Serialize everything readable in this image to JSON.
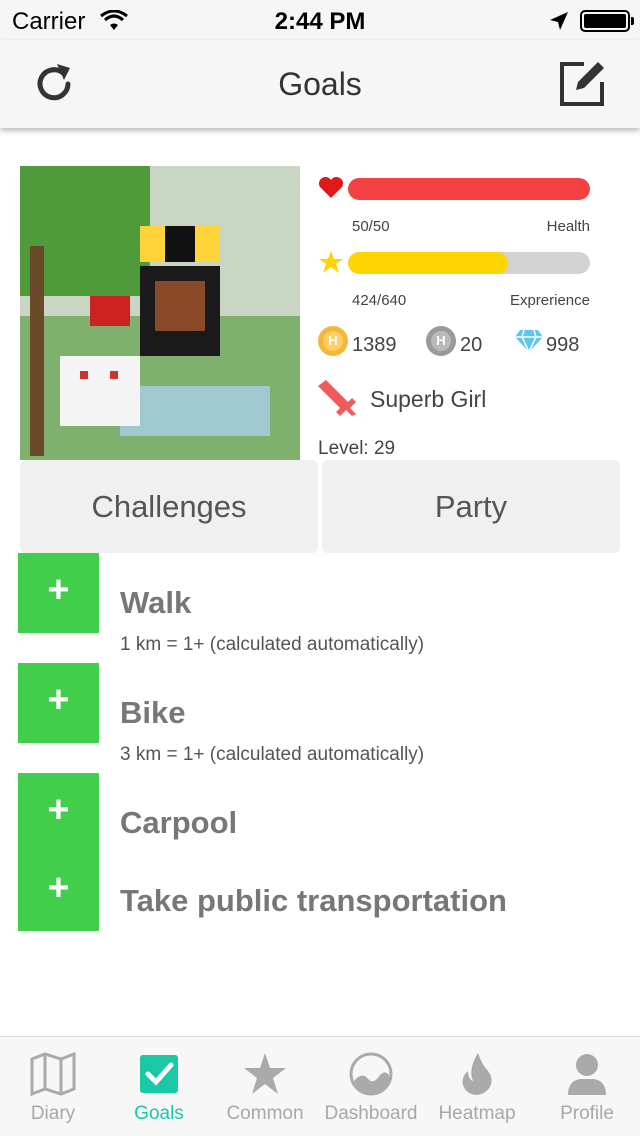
{
  "status_bar": {
    "carrier": "Carrier",
    "time": "2:44 PM"
  },
  "nav": {
    "title": "Goals",
    "left_icon": "refresh-icon",
    "right_icon": "edit-icon"
  },
  "stats": {
    "health": {
      "value": "50/50",
      "label": "Health",
      "fraction": 1.0,
      "color": "#f44040"
    },
    "experience": {
      "value": "424/640",
      "label": "Exprerience",
      "fraction": 0.6625,
      "color": "#ffd500"
    },
    "gold": "1389",
    "silver": "20",
    "gems": "998",
    "class_name": "Superb Girl",
    "level": "Level: 29"
  },
  "tabs": [
    {
      "label": "Challenges"
    },
    {
      "label": "Party"
    }
  ],
  "habits": [
    {
      "title": "Walk",
      "note": "1 km = 1+ (calculated automatically)"
    },
    {
      "title": "Bike",
      "note": "3 km = 1+ (calculated automatically)"
    },
    {
      "title": "Carpool",
      "note": ""
    },
    {
      "title": "Take public transportation",
      "note": ""
    }
  ],
  "tab_bar": [
    {
      "label": "Diary",
      "icon": "map-icon"
    },
    {
      "label": "Goals",
      "icon": "checkbox-icon",
      "active": true
    },
    {
      "label": "Common",
      "icon": "star-icon"
    },
    {
      "label": "Dashboard",
      "icon": "gauge-icon"
    },
    {
      "label": "Heatmap",
      "icon": "flame-icon"
    },
    {
      "label": "Profile",
      "icon": "person-icon"
    }
  ],
  "colors": {
    "accent": "#1bc8a4",
    "plus_button": "#41ce4a",
    "health": "#f44040",
    "experience": "#ffd500"
  }
}
